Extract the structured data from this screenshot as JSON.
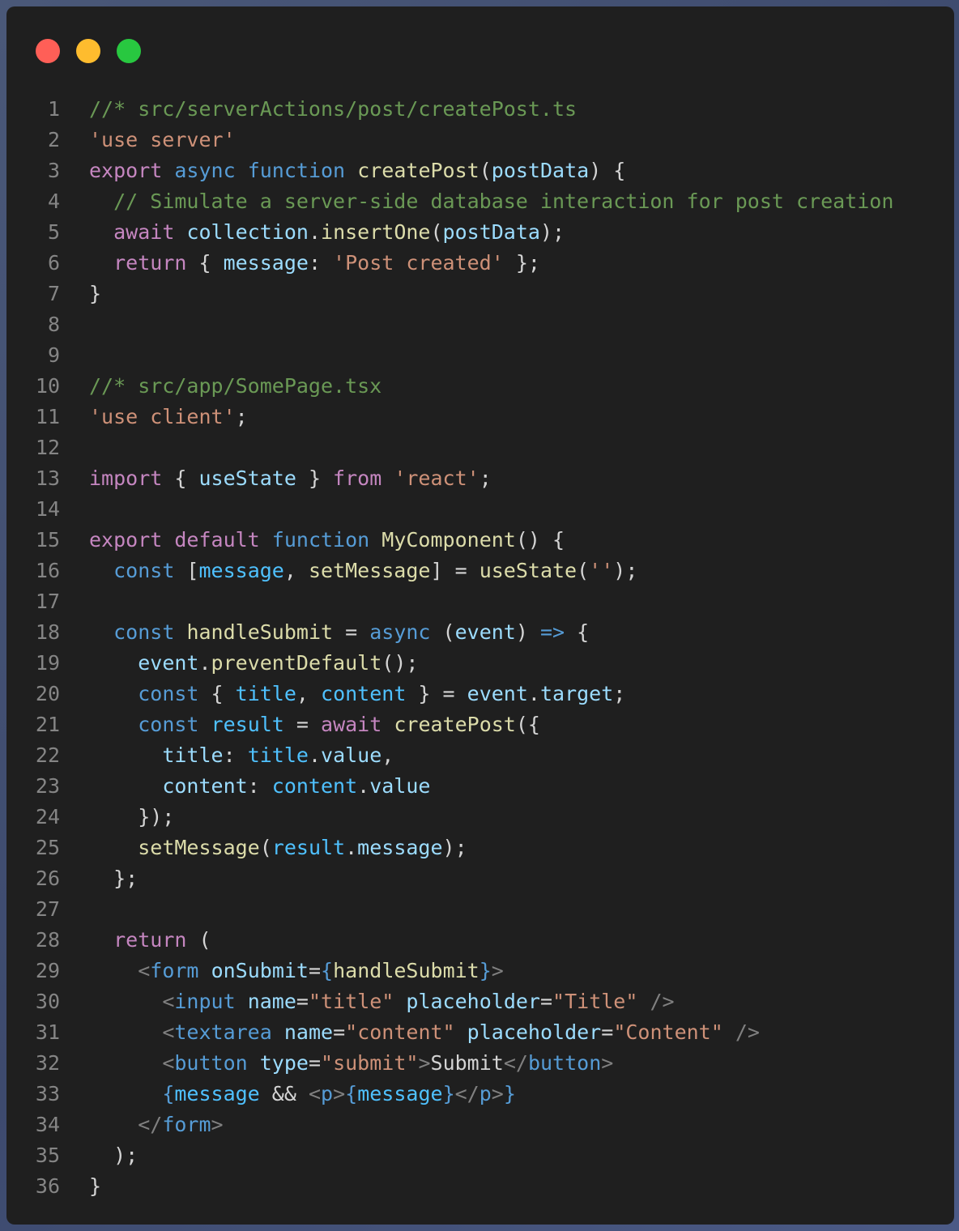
{
  "window": {
    "controls": [
      {
        "name": "close",
        "color": "#ff5f57"
      },
      {
        "name": "minimize",
        "color": "#febc2e"
      },
      {
        "name": "maximize",
        "color": "#28c840"
      }
    ]
  },
  "token_colors": {
    "c": "#6a9955",
    "s": "#ce9178",
    "k": "#c586c0",
    "b": "#569cd6",
    "f": "#dcdcaa",
    "v": "#9cdcfe",
    "cv": "#4fc1ff",
    "p": "#d4d4d4",
    "g": "#808080"
  },
  "lines": [
    [
      [
        "//* src/serverActions/post/createPost.ts",
        "c"
      ]
    ],
    [
      [
        "'use server'",
        "s"
      ]
    ],
    [
      [
        "export",
        "k"
      ],
      [
        " ",
        "p"
      ],
      [
        "async",
        "b"
      ],
      [
        " ",
        "p"
      ],
      [
        "function",
        "b"
      ],
      [
        " ",
        "p"
      ],
      [
        "createPost",
        "f"
      ],
      [
        "(",
        "p"
      ],
      [
        "postData",
        "v"
      ],
      [
        ") {",
        "p"
      ]
    ],
    [
      [
        "  ",
        "p"
      ],
      [
        "// Simulate a server-side database interaction for post creation",
        "c"
      ]
    ],
    [
      [
        "  ",
        "p"
      ],
      [
        "await",
        "k"
      ],
      [
        " ",
        "p"
      ],
      [
        "collection",
        "v"
      ],
      [
        ".",
        "p"
      ],
      [
        "insertOne",
        "f"
      ],
      [
        "(",
        "p"
      ],
      [
        "postData",
        "v"
      ],
      [
        ");",
        "p"
      ]
    ],
    [
      [
        "  ",
        "p"
      ],
      [
        "return",
        "k"
      ],
      [
        " { ",
        "p"
      ],
      [
        "message",
        "v"
      ],
      [
        ": ",
        "p"
      ],
      [
        "'Post created'",
        "s"
      ],
      [
        " };",
        "p"
      ]
    ],
    [
      [
        "}",
        "p"
      ]
    ],
    [],
    [],
    [
      [
        "//* src/app/SomePage.tsx",
        "c"
      ]
    ],
    [
      [
        "'use client'",
        "s"
      ],
      [
        ";",
        "p"
      ]
    ],
    [],
    [
      [
        "import",
        "k"
      ],
      [
        " { ",
        "p"
      ],
      [
        "useState",
        "v"
      ],
      [
        " } ",
        "p"
      ],
      [
        "from",
        "k"
      ],
      [
        " ",
        "p"
      ],
      [
        "'react'",
        "s"
      ],
      [
        ";",
        "p"
      ]
    ],
    [],
    [
      [
        "export",
        "k"
      ],
      [
        " ",
        "p"
      ],
      [
        "default",
        "k"
      ],
      [
        " ",
        "p"
      ],
      [
        "function",
        "b"
      ],
      [
        " ",
        "p"
      ],
      [
        "MyComponent",
        "f"
      ],
      [
        "() {",
        "p"
      ]
    ],
    [
      [
        "  ",
        "p"
      ],
      [
        "const",
        "b"
      ],
      [
        " [",
        "p"
      ],
      [
        "message",
        "cv"
      ],
      [
        ", ",
        "p"
      ],
      [
        "setMessage",
        "f"
      ],
      [
        "] = ",
        "p"
      ],
      [
        "useState",
        "f"
      ],
      [
        "(",
        "p"
      ],
      [
        "''",
        "s"
      ],
      [
        ");",
        "p"
      ]
    ],
    [],
    [
      [
        "  ",
        "p"
      ],
      [
        "const",
        "b"
      ],
      [
        " ",
        "p"
      ],
      [
        "handleSubmit",
        "f"
      ],
      [
        " = ",
        "p"
      ],
      [
        "async",
        "b"
      ],
      [
        " (",
        "p"
      ],
      [
        "event",
        "v"
      ],
      [
        ") ",
        "p"
      ],
      [
        "=>",
        "b"
      ],
      [
        " {",
        "p"
      ]
    ],
    [
      [
        "    ",
        "p"
      ],
      [
        "event",
        "v"
      ],
      [
        ".",
        "p"
      ],
      [
        "preventDefault",
        "f"
      ],
      [
        "();",
        "p"
      ]
    ],
    [
      [
        "    ",
        "p"
      ],
      [
        "const",
        "b"
      ],
      [
        " { ",
        "p"
      ],
      [
        "title",
        "cv"
      ],
      [
        ", ",
        "p"
      ],
      [
        "content",
        "cv"
      ],
      [
        " } = ",
        "p"
      ],
      [
        "event",
        "v"
      ],
      [
        ".",
        "p"
      ],
      [
        "target",
        "v"
      ],
      [
        ";",
        "p"
      ]
    ],
    [
      [
        "    ",
        "p"
      ],
      [
        "const",
        "b"
      ],
      [
        " ",
        "p"
      ],
      [
        "result",
        "cv"
      ],
      [
        " = ",
        "p"
      ],
      [
        "await",
        "k"
      ],
      [
        " ",
        "p"
      ],
      [
        "createPost",
        "f"
      ],
      [
        "({",
        "p"
      ]
    ],
    [
      [
        "      ",
        "p"
      ],
      [
        "title",
        "v"
      ],
      [
        ": ",
        "p"
      ],
      [
        "title",
        "cv"
      ],
      [
        ".",
        "p"
      ],
      [
        "value",
        "v"
      ],
      [
        ",",
        "p"
      ]
    ],
    [
      [
        "      ",
        "p"
      ],
      [
        "content",
        "v"
      ],
      [
        ": ",
        "p"
      ],
      [
        "content",
        "cv"
      ],
      [
        ".",
        "p"
      ],
      [
        "value",
        "v"
      ]
    ],
    [
      [
        "    });",
        "p"
      ]
    ],
    [
      [
        "    ",
        "p"
      ],
      [
        "setMessage",
        "f"
      ],
      [
        "(",
        "p"
      ],
      [
        "result",
        "cv"
      ],
      [
        ".",
        "p"
      ],
      [
        "message",
        "v"
      ],
      [
        ");",
        "p"
      ]
    ],
    [
      [
        "  };",
        "p"
      ]
    ],
    [],
    [
      [
        "  ",
        "p"
      ],
      [
        "return",
        "k"
      ],
      [
        " (",
        "p"
      ]
    ],
    [
      [
        "    ",
        "p"
      ],
      [
        "<",
        "g"
      ],
      [
        "form",
        "b"
      ],
      [
        " ",
        "p"
      ],
      [
        "onSubmit",
        "v"
      ],
      [
        "=",
        "p"
      ],
      [
        "{",
        "b"
      ],
      [
        "handleSubmit",
        "f"
      ],
      [
        "}",
        "b"
      ],
      [
        ">",
        "g"
      ]
    ],
    [
      [
        "      ",
        "p"
      ],
      [
        "<",
        "g"
      ],
      [
        "input",
        "b"
      ],
      [
        " ",
        "p"
      ],
      [
        "name",
        "v"
      ],
      [
        "=",
        "p"
      ],
      [
        "\"title\"",
        "s"
      ],
      [
        " ",
        "p"
      ],
      [
        "placeholder",
        "v"
      ],
      [
        "=",
        "p"
      ],
      [
        "\"Title\"",
        "s"
      ],
      [
        " />",
        "g"
      ]
    ],
    [
      [
        "      ",
        "p"
      ],
      [
        "<",
        "g"
      ],
      [
        "textarea",
        "b"
      ],
      [
        " ",
        "p"
      ],
      [
        "name",
        "v"
      ],
      [
        "=",
        "p"
      ],
      [
        "\"content\"",
        "s"
      ],
      [
        " ",
        "p"
      ],
      [
        "placeholder",
        "v"
      ],
      [
        "=",
        "p"
      ],
      [
        "\"Content\"",
        "s"
      ],
      [
        " />",
        "g"
      ]
    ],
    [
      [
        "      ",
        "p"
      ],
      [
        "<",
        "g"
      ],
      [
        "button",
        "b"
      ],
      [
        " ",
        "p"
      ],
      [
        "type",
        "v"
      ],
      [
        "=",
        "p"
      ],
      [
        "\"submit\"",
        "s"
      ],
      [
        ">",
        "g"
      ],
      [
        "Submit",
        "p"
      ],
      [
        "</",
        "g"
      ],
      [
        "button",
        "b"
      ],
      [
        ">",
        "g"
      ]
    ],
    [
      [
        "      ",
        "p"
      ],
      [
        "{",
        "b"
      ],
      [
        "message",
        "cv"
      ],
      [
        " && ",
        "p"
      ],
      [
        "<",
        "g"
      ],
      [
        "p",
        "b"
      ],
      [
        ">",
        "g"
      ],
      [
        "{",
        "b"
      ],
      [
        "message",
        "cv"
      ],
      [
        "}",
        "b"
      ],
      [
        "</",
        "g"
      ],
      [
        "p",
        "b"
      ],
      [
        ">",
        "g"
      ],
      [
        "}",
        "b"
      ]
    ],
    [
      [
        "    ",
        "p"
      ],
      [
        "</",
        "g"
      ],
      [
        "form",
        "b"
      ],
      [
        ">",
        "g"
      ]
    ],
    [
      [
        "  );",
        "p"
      ]
    ],
    [
      [
        "}",
        "p"
      ]
    ]
  ]
}
